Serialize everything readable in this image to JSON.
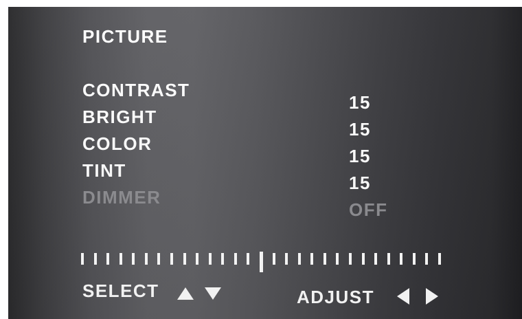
{
  "menu": {
    "title": "PICTURE",
    "items": [
      {
        "label": "CONTRAST",
        "value": "15"
      },
      {
        "label": "BRIGHT",
        "value": "15"
      },
      {
        "label": "COLOR",
        "value": "15"
      },
      {
        "label": "TINT",
        "value": "15"
      },
      {
        "label": "DIMMER",
        "value": "OFF"
      }
    ]
  },
  "scale": {
    "level": 0.5
  },
  "footer": {
    "select_label": "SELECT",
    "adjust_label": "ADJUST",
    "select_icons": [
      "arrow-up-icon",
      "arrow-down-icon"
    ],
    "adjust_icons": [
      "arrow-left-icon",
      "arrow-right-icon"
    ]
  },
  "colors": {
    "text": "#ffffff",
    "disabled_text": "#8f8f93"
  }
}
